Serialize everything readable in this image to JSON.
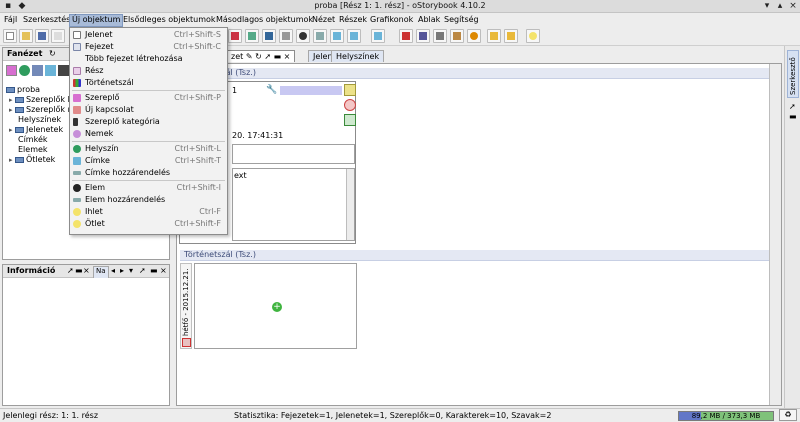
{
  "window": {
    "title": "proba [Rész 1: 1. rész] - oStorybook 4.10.2"
  },
  "menubar": {
    "items": [
      "Fájl",
      "Szerkesztés",
      "Új objektum",
      "Elsődleges objektumok",
      "Másodlagos objektumok",
      "Nézet",
      "Részek",
      "Grafikonok",
      "Ablak",
      "Segítség"
    ]
  },
  "new_object_menu": {
    "items": [
      {
        "label": "Jelenet",
        "shortcut": "Ctrl+Shift-S",
        "icon": "scene-icon"
      },
      {
        "label": "Fejezet",
        "shortcut": "Ctrl+Shift-C",
        "icon": "chapter-icon"
      },
      {
        "label": "Több fejezet létrehozása",
        "shortcut": "",
        "icon": ""
      },
      {
        "label": "Rész",
        "shortcut": "",
        "icon": "part-icon"
      },
      {
        "label": "Történetszál",
        "shortcut": "",
        "icon": "strand-icon"
      },
      {
        "label": "Szereplő",
        "shortcut": "Ctrl+Shift-P",
        "icon": "person-icon"
      },
      {
        "label": "Új kapcsolat",
        "shortcut": "",
        "icon": "relation-icon"
      },
      {
        "label": "Szereplő kategória",
        "shortcut": "",
        "icon": "category-icon"
      },
      {
        "label": "Nemek",
        "shortcut": "",
        "icon": "gender-icon"
      },
      {
        "label": "Helyszín",
        "shortcut": "Ctrl+Shift-L",
        "icon": "location-icon"
      },
      {
        "label": "Címke",
        "shortcut": "Ctrl+Shift-T",
        "icon": "tag-icon"
      },
      {
        "label": "Címke hozzárendelés",
        "shortcut": "",
        "icon": "tag-link-icon"
      },
      {
        "label": "Elem",
        "shortcut": "Ctrl+Shift-I",
        "icon": "item-icon"
      },
      {
        "label": "Elem hozzárendelés",
        "shortcut": "",
        "icon": "item-link-icon"
      },
      {
        "label": "Ihlet",
        "shortcut": "Ctrl-F",
        "icon": "idea-icon"
      },
      {
        "label": "Ötlet",
        "shortcut": "Ctrl+Shift-F",
        "icon": "memo-icon"
      }
    ]
  },
  "left_panel": {
    "title": "Fanézet",
    "tree": [
      "proba",
      "Szereplők k",
      "Szereplők n",
      "Helyszínek",
      "Jelenetek",
      "Címkék",
      "Elemek",
      "Ötletek"
    ]
  },
  "info_panel": {
    "title": "Információ",
    "tab": "Na"
  },
  "tabs": [
    "zet",
    "Jelenetek",
    "Helyszínek"
  ],
  "main": {
    "strand_label_top": "Történetszál (Tsz.)",
    "card_number": "1",
    "card_date": "20. 17:41:31",
    "card_text": "ext",
    "strand_label_bottom": "Történetszál (Tsz.)",
    "date_vertical": "hétfő - 2015.12.21."
  },
  "right_sidebar": {
    "tab": "Szerkesztő"
  },
  "status": {
    "current_part": "Jelenlegi rész: 1: 1. rész",
    "stats": "Statisztika: Fejezetek=1, Jelenetek=1, Szereplők=0, Karakterek=10, Szavak=2",
    "memory": "89,2 MB / 373,3 MB",
    "memory_fraction": 0.239
  },
  "colors": {
    "menu_highlight": "#a8bbd8",
    "tab_bg": "#dfe6f3",
    "memory_fill": "#6277c8"
  }
}
